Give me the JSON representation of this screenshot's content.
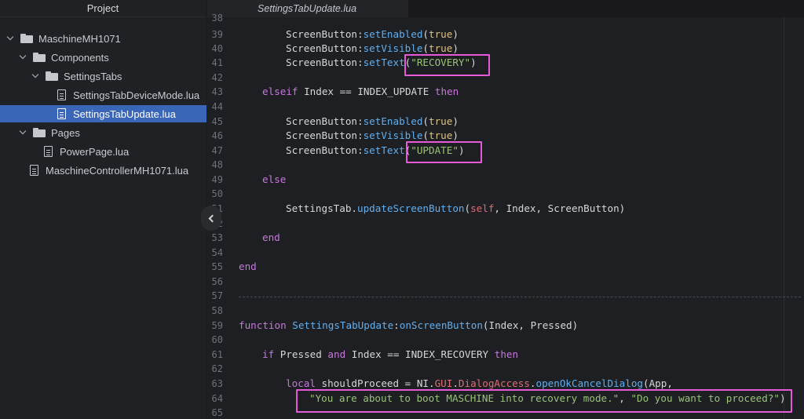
{
  "sidebar": {
    "title": "Project",
    "items": [
      {
        "label": "MaschineMH1071",
        "type": "folder",
        "expanded": true
      },
      {
        "label": "Components",
        "type": "folder",
        "expanded": true
      },
      {
        "label": "SettingsTabs",
        "type": "folder",
        "expanded": true
      },
      {
        "label": "SettingsTabDeviceMode.lua",
        "type": "file"
      },
      {
        "label": "SettingsTabUpdate.lua",
        "type": "file",
        "selected": true
      },
      {
        "label": "Pages",
        "type": "folder",
        "expanded": true
      },
      {
        "label": "PowerPage.lua",
        "type": "file"
      },
      {
        "label": "MaschineControllerMH1071.lua",
        "type": "file"
      }
    ]
  },
  "editor": {
    "active_tab": "SettingsTabUpdate.lua",
    "line_numbers": [
      "38",
      "39",
      "40",
      "41",
      "42",
      "43",
      "44",
      "45",
      "46",
      "47",
      "48",
      "49",
      "50",
      "51",
      "52",
      "53",
      "54",
      "55",
      "56",
      "57",
      "58",
      "59",
      "60",
      "61",
      "62",
      "63",
      "64",
      "65"
    ],
    "code": {
      "l39": {
        "obj": "ScreenButton",
        "sep": ":",
        "method": "setEnabled",
        "open": "(",
        "arg": "true",
        "close": ")"
      },
      "l40": {
        "obj": "ScreenButton",
        "sep": ":",
        "method": "setVisible",
        "open": "(",
        "arg": "true",
        "close": ")"
      },
      "l41": {
        "obj": "ScreenButton",
        "sep": ":",
        "method": "setText",
        "open": "(",
        "arg": "\"RECOVERY\"",
        "close": ")"
      },
      "l43": {
        "kw": "elseif",
        "rest": " Index == INDEX_UPDATE ",
        "kw2": "then"
      },
      "l45": {
        "obj": "ScreenButton",
        "sep": ":",
        "method": "setEnabled",
        "open": "(",
        "arg": "true",
        "close": ")"
      },
      "l46": {
        "obj": "ScreenButton",
        "sep": ":",
        "method": "setVisible",
        "open": "(",
        "arg": "true",
        "close": ")"
      },
      "l47": {
        "obj": "ScreenButton",
        "sep": ":",
        "method": "setText",
        "open": "(",
        "arg": "\"UPDATE\"",
        "close": ")"
      },
      "l49": {
        "kw": "else"
      },
      "l51": {
        "obj": "SettingsTab",
        "sep": ".",
        "method": "updateScreenButton",
        "open": "(",
        "self": "self",
        "rest": ", Index, ScreenButton)"
      },
      "l53": {
        "kw": "end"
      },
      "l55": {
        "kw": "end"
      },
      "l59": {
        "kw": "function",
        "name": " SettingsTabUpdate",
        "sep": ":",
        "method": "onScreenButton",
        "rest": "(Index, Pressed)"
      },
      "l61": {
        "kw": "if",
        "a": " Pressed ",
        "kw2": "and",
        "b": " Index == INDEX_RECOVERY ",
        "kw3": "then"
      },
      "l63": {
        "kw": "local",
        "var": " shouldProceed",
        "eq": " = NI.",
        "gui": "GUI",
        "dot": ".",
        "cls": "DialogAccess",
        "dot2": ".",
        "method": "openOkCancelDialog",
        "rest": "(App,"
      },
      "l64": {
        "str1": "\"You are about to boot MASCHINE into recovery mode.\"",
        "comma": ", ",
        "str2": "\"Do you want to proceed?\"",
        "close": ")"
      }
    }
  },
  "colors": {
    "highlight": "#e65ad8",
    "selection": "#3a66b8",
    "keyword": "#c678dd",
    "function": "#61afef",
    "string": "#98c379",
    "boolean": "#dcc183"
  }
}
